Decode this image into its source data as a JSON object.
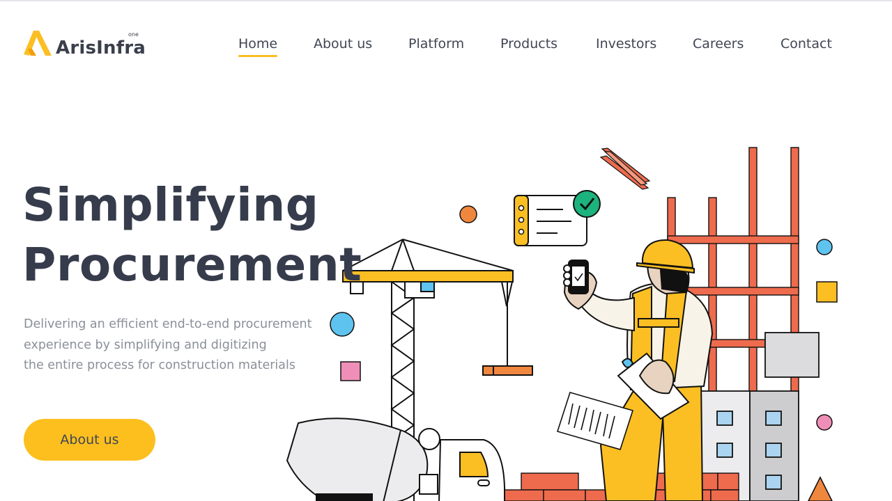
{
  "brand": {
    "name": "ArisInfra",
    "suffix": "one"
  },
  "nav": {
    "items": [
      {
        "label": "Home",
        "active": true
      },
      {
        "label": "About us",
        "active": false
      },
      {
        "label": "Platform",
        "active": false
      },
      {
        "label": "Products",
        "active": false
      },
      {
        "label": "Investors",
        "active": false
      },
      {
        "label": "Careers",
        "active": false
      },
      {
        "label": "Contact",
        "active": false
      }
    ]
  },
  "hero": {
    "title_line1": "Simplifying",
    "title_line2": "Procurement",
    "subtitle_lines": [
      "Delivering an efficient end-to-end procurement",
      "experience by simplifying and digitizing",
      "the entire process for construction materials"
    ],
    "cta_label": "About us"
  },
  "colors": {
    "accent": "#fcbf1e",
    "text_dark": "#363c4b",
    "text_muted": "#8a8f99",
    "scaffold": "#ee6b4d",
    "check": "#1db37c",
    "sky": "#5fc3ef",
    "pink": "#ef8fb8"
  },
  "icons": {
    "logo": "arisinfra-chevron-logo",
    "check": "check-circle-icon"
  }
}
